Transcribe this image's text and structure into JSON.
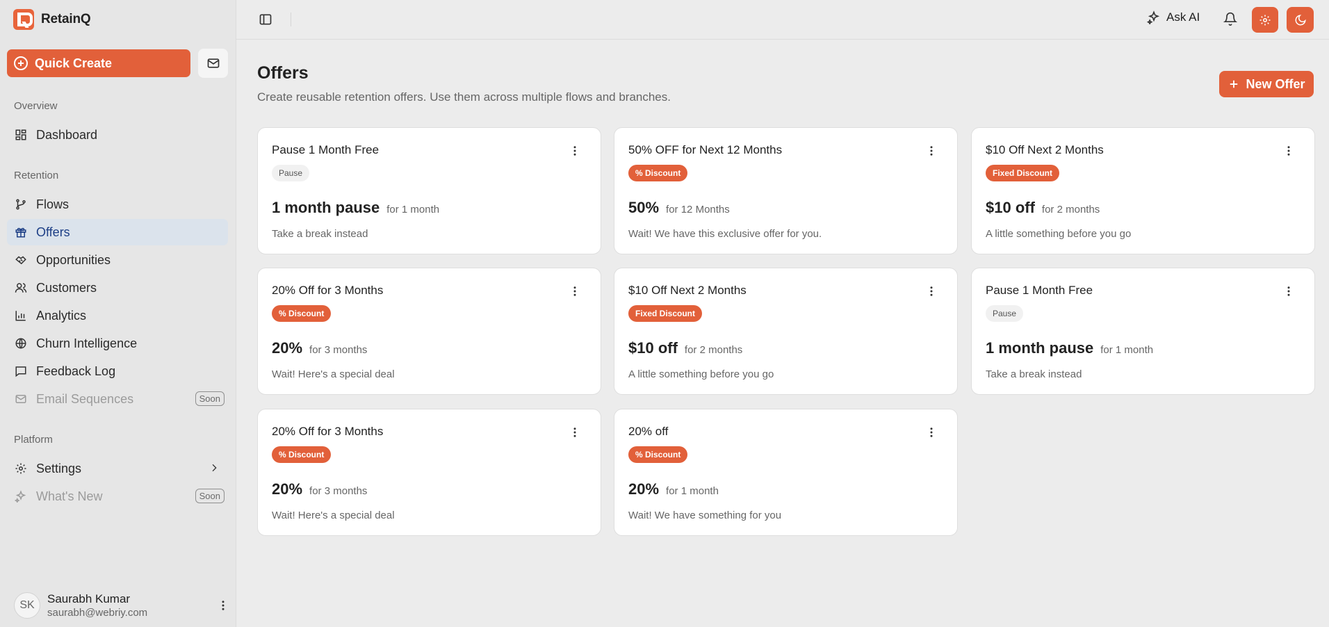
{
  "app": {
    "name": "RetainQ"
  },
  "sidebar": {
    "quick_create": "Quick Create",
    "sections": {
      "overview": "Overview",
      "retention": "Retention",
      "platform": "Platform"
    },
    "items": {
      "dashboard": "Dashboard",
      "flows": "Flows",
      "offers": "Offers",
      "opportunities": "Opportunities",
      "customers": "Customers",
      "analytics": "Analytics",
      "churn": "Churn Intelligence",
      "feedback": "Feedback Log",
      "email": "Email Sequences",
      "settings": "Settings",
      "whats_new": "What's New"
    },
    "soon_label": "Soon",
    "user": {
      "initials": "SK",
      "name": "Saurabh Kumar",
      "email": "saurabh@webriy.com"
    }
  },
  "topbar": {
    "ask_ai": "Ask AI"
  },
  "page": {
    "title": "Offers",
    "subtitle": "Create reusable retention offers. Use them across multiple flows and branches.",
    "new_offer": "New Offer"
  },
  "offers": [
    {
      "title": "Pause 1 Month Free",
      "badge": "Pause",
      "type": "pause",
      "value": "1 month pause",
      "duration": "for 1 month",
      "description": "Take a break instead"
    },
    {
      "title": "50% OFF for Next 12 Months",
      "badge": "% Discount",
      "type": "discount",
      "value": "50%",
      "duration": "for 12 Months",
      "description": "Wait! We have this exclusive offer for you."
    },
    {
      "title": "$10 Off Next 2 Months",
      "badge": "Fixed Discount",
      "type": "discount",
      "value": "$10 off",
      "duration": "for 2 months",
      "description": "A little something before you go"
    },
    {
      "title": "20% Off for 3 Months",
      "badge": "% Discount",
      "type": "discount",
      "value": "20%",
      "duration": "for 3 months",
      "description": "Wait! Here's a special deal"
    },
    {
      "title": "$10 Off Next 2 Months",
      "badge": "Fixed Discount",
      "type": "discount",
      "value": "$10 off",
      "duration": "for 2 months",
      "description": "A little something before you go"
    },
    {
      "title": "Pause 1 Month Free",
      "badge": "Pause",
      "type": "pause",
      "value": "1 month pause",
      "duration": "for 1 month",
      "description": "Take a break instead"
    },
    {
      "title": "20% Off for 3 Months",
      "badge": "% Discount",
      "type": "discount",
      "value": "20%",
      "duration": "for 3 months",
      "description": "Wait! Here's a special deal"
    },
    {
      "title": "20% off",
      "badge": "% Discount",
      "type": "discount",
      "value": "20%",
      "duration": "for 1 month",
      "description": "Wait! We have something for you"
    }
  ],
  "colors": {
    "accent": "#e2603a",
    "active_nav_bg": "#dbe3ec",
    "active_nav_text": "#1d3f86"
  }
}
